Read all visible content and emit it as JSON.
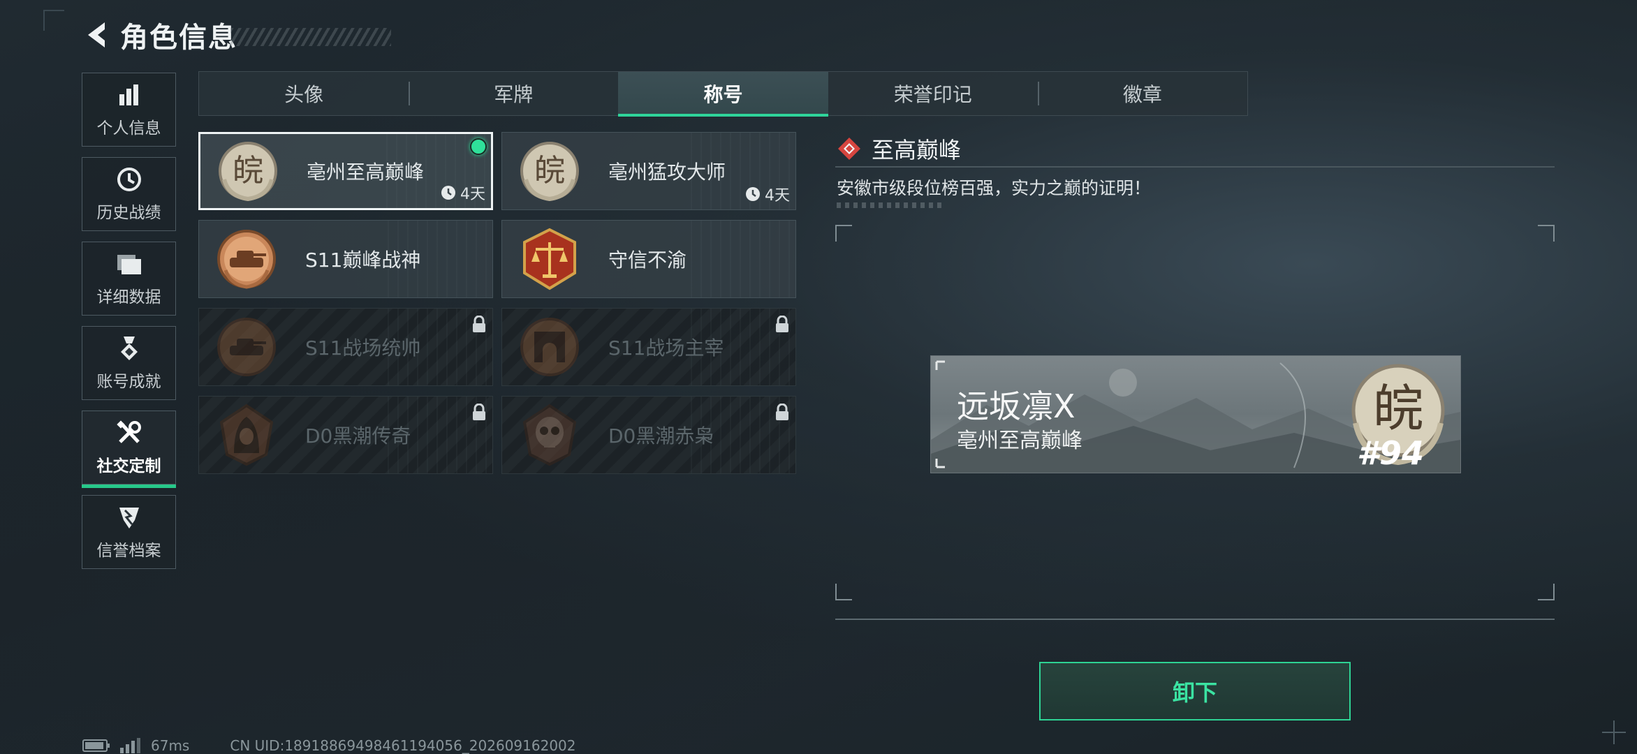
{
  "header": {
    "title": "角色信息"
  },
  "nav": {
    "items": [
      {
        "label": "个人信息",
        "icon": "bar-chart-icon"
      },
      {
        "label": "历史战绩",
        "icon": "history-clock-icon"
      },
      {
        "label": "详细数据",
        "icon": "folder-icon"
      },
      {
        "label": "账号成就",
        "icon": "achievement-medal-icon"
      },
      {
        "label": "社交定制",
        "icon": "tools-icon",
        "active": true
      },
      {
        "label": "信誉档案",
        "icon": "shield-badge-icon"
      }
    ]
  },
  "tabs": [
    {
      "label": "头像"
    },
    {
      "label": "军牌"
    },
    {
      "label": "称号",
      "active": true
    },
    {
      "label": "荣誉印记"
    },
    {
      "label": "徽章"
    }
  ],
  "cards": [
    {
      "label": "亳州至高巅峰",
      "timer": "4天",
      "selected": true,
      "equipped": true,
      "medal": "wan-medal"
    },
    {
      "label": "亳州猛攻大师",
      "timer": "4天",
      "medal": "wan-medal"
    },
    {
      "label": "S11巅峰战神",
      "medal": "tank-medal"
    },
    {
      "label": "守信不渝",
      "medal": "scales-medal"
    },
    {
      "label": "S11战场统帅",
      "locked": true,
      "medal": "tank-medal"
    },
    {
      "label": "S11战场主宰",
      "locked": true,
      "medal": "arch-medal"
    },
    {
      "label": "D0黑潮传奇",
      "locked": true,
      "medal": "hooded-medal"
    },
    {
      "label": "D0黑潮赤枭",
      "locked": true,
      "medal": "skull-medal"
    }
  ],
  "detail": {
    "title": "至高巅峰",
    "description": "安徽市级段位榜百强，实力之巅的证明！"
  },
  "nameplate": {
    "player_name": "远坂凛X",
    "title": "亳州至高巅峰",
    "rank": "#94",
    "medal_char": "皖"
  },
  "action": {
    "unequip_label": "卸下"
  },
  "footer": {
    "ping": "67ms",
    "uid": "CN UID:18918869498461194056_202609162002"
  },
  "colors": {
    "accent": "#2fd49a",
    "equipped": "#2fe09a",
    "lock": "#cfd5d8"
  }
}
